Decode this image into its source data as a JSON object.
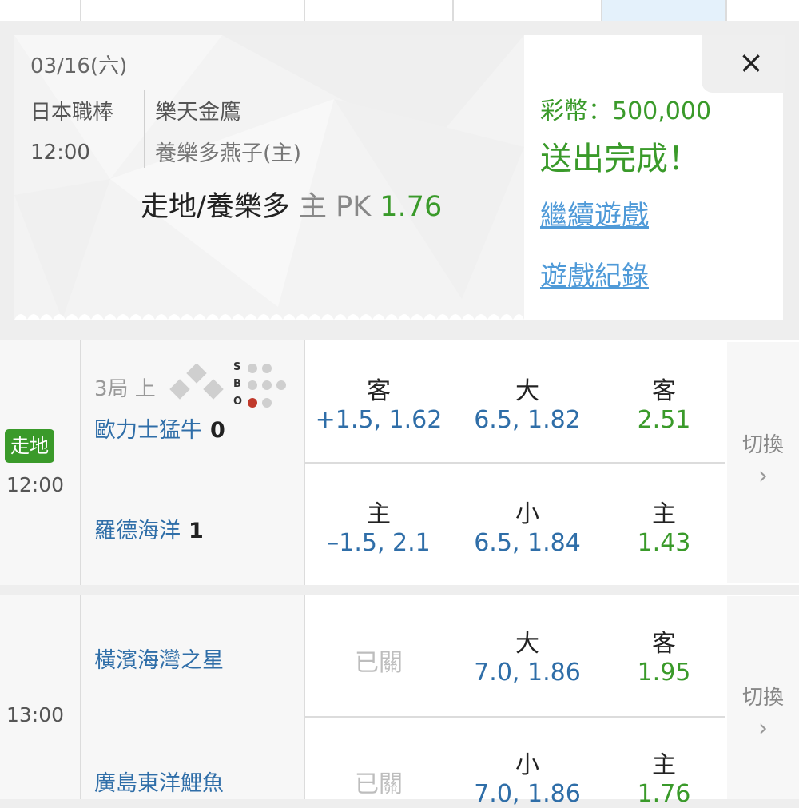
{
  "ticket": {
    "date": "03/16(六)",
    "league": "日本職棒",
    "time": "12:00",
    "away_team": "樂天金鷹",
    "home_team": "養樂多燕子(主)",
    "pick_text": "走地/養樂多",
    "pick_side": "主",
    "pick_type": "PK",
    "pick_odds": "1.76",
    "coins": "彩幣：500,000",
    "status": "送出完成！",
    "continue_link": "繼續遊戲",
    "history_link": "遊戲紀錄",
    "close_icon": "×"
  },
  "match1": {
    "badge": "走地",
    "time": "12:00",
    "inning": "3局 上",
    "sbo_labels": [
      "S",
      "B",
      "O"
    ],
    "away": {
      "name": "歐力士猛牛",
      "score": "0"
    },
    "home": {
      "name": "羅德海洋",
      "score": "1"
    },
    "spread": {
      "away_label": "客",
      "away_value": "+1.5, 1.62",
      "home_label": "主",
      "home_value": "–1.5, 2.1"
    },
    "total": {
      "over_label": "大",
      "over_value": "6.5, 1.82",
      "under_label": "小",
      "under_value": "6.5, 1.84"
    },
    "moneyline": {
      "away_label": "客",
      "away_value": "2.51",
      "home_label": "主",
      "home_value": "1.43"
    },
    "switch_label": "切換",
    "switch_icon": "chevron-right-icon"
  },
  "match2": {
    "time": "13:00",
    "away": {
      "name": "橫濱海灣之星"
    },
    "home": {
      "name": "廣島東洋鯉魚"
    },
    "spread_closed": "已關",
    "total": {
      "over_label": "大",
      "over_value": "7.0, 1.86",
      "under_label": "小",
      "under_value": "7.0, 1.86"
    },
    "moneyline": {
      "away_label": "客",
      "away_value": "1.95",
      "home_label": "主",
      "home_value": "1.76"
    },
    "switch_label": "切換",
    "switch_icon": "chevron-right-icon"
  },
  "colors": {
    "green": "#3a9a2a",
    "blue_text": "#2f6ea8",
    "link_blue": "#4f9ad8",
    "highlight_cell": "#e4f1fb"
  }
}
